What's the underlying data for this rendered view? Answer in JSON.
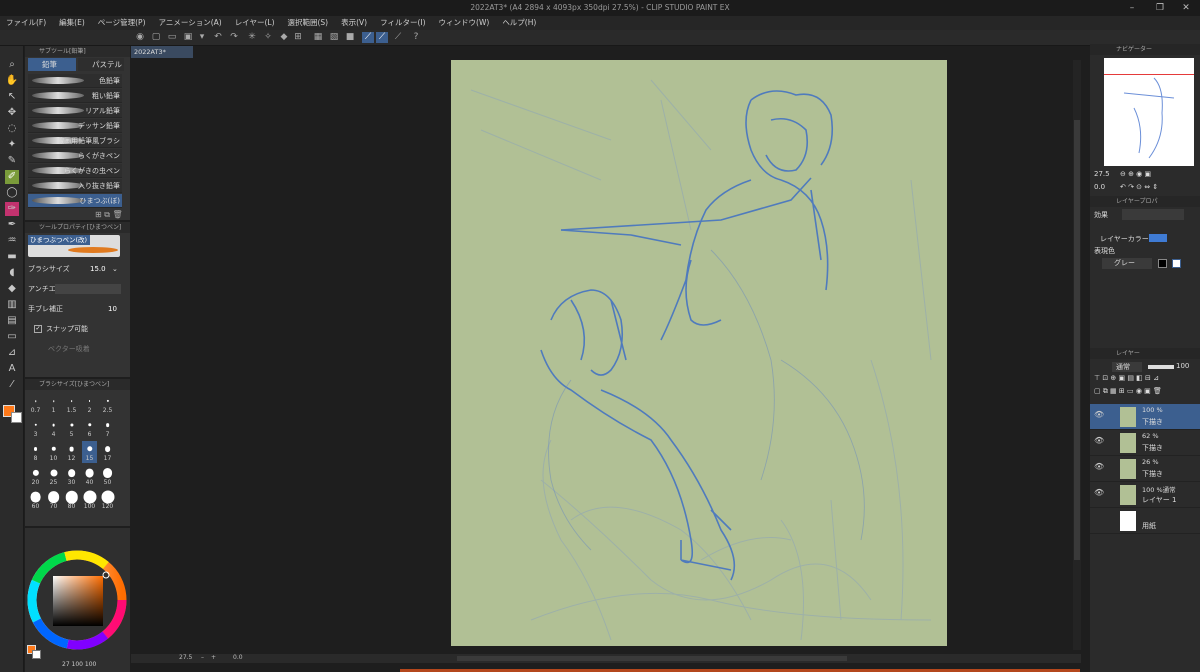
{
  "window": {
    "title": "2022AT3* (A4 2894 x 4093px 350dpi 27.5%) - CLIP STUDIO PAINT EX"
  },
  "menu": [
    "ファイル(F)",
    "編集(E)",
    "ページ管理(P)",
    "アニメーション(A)",
    "レイヤー(L)",
    "選択範囲(S)",
    "表示(V)",
    "フィルター(I)",
    "ウィンドウ(W)",
    "ヘルプ(H)"
  ],
  "subtool": {
    "header": "サブツール[鉛筆]",
    "tabs": [
      "鉛筆",
      "パステル"
    ],
    "brushes": [
      "色鉛筆",
      "粗い鉛筆",
      "リアル鉛筆",
      "デッサン鉛筆",
      "線画用鉛筆風ブラシ",
      "らくがきペン",
      "らくがきの虫ペン",
      "入り抜き鉛筆",
      "ひまつぶ(ぼ)"
    ],
    "selected_index": 8
  },
  "toolprop": {
    "header": "ツールプロパティ[ひまつべン]",
    "brush_name": "ひまつぶつぺン(改)",
    "size_label": "ブラシサイズ",
    "size_value": "15.0",
    "antialias_label": "アンチエイ",
    "stabilize_label": "手ブレ補正",
    "stabilize_value": "10",
    "snap_label": "スナップ可能",
    "vector_label": "ベクター吸着"
  },
  "brushsize": {
    "header": "ブラシサイズ[ひまつべン]",
    "sizes": [
      "0.7",
      "1",
      "1.5",
      "2",
      "2.5",
      "3",
      "4",
      "5",
      "6",
      "7",
      "8",
      "10",
      "12",
      "15",
      "17",
      "20",
      "25",
      "30",
      "40",
      "50",
      "60",
      "70",
      "80",
      "100",
      "120"
    ],
    "selected": "15"
  },
  "colors": {
    "main": "#ff7a1a",
    "sub": "#ffffff",
    "accent": "#3c5f8f",
    "paper": "#b1c095",
    "sketch": "#3f6fc4",
    "footer_text": "27 100 100"
  },
  "canvas": {
    "doc_tab": "2022AT3*"
  },
  "status": {
    "zoom": "27.5",
    "angle": "0.0"
  },
  "navigator": {
    "header": "ナビゲーター",
    "zoom": "27.5",
    "angle": "0.0"
  },
  "layerprop": {
    "header": "レイヤープロパ",
    "effect_label": "効果",
    "layer_color_label": "レイヤーカラー",
    "expression_label": "表現色",
    "expression_value": "グレー"
  },
  "layers": {
    "header": "レイヤー",
    "blend_mode": "通常",
    "opacity": "100",
    "items": [
      {
        "pct": "100 %",
        "name": "下描き"
      },
      {
        "pct": "62 %",
        "name": "下描き"
      },
      {
        "pct": "26 %",
        "name": "下描き"
      },
      {
        "pct": "100 %通常",
        "name": "レイヤー 1"
      },
      {
        "pct": "",
        "name": "用紙"
      }
    ]
  }
}
